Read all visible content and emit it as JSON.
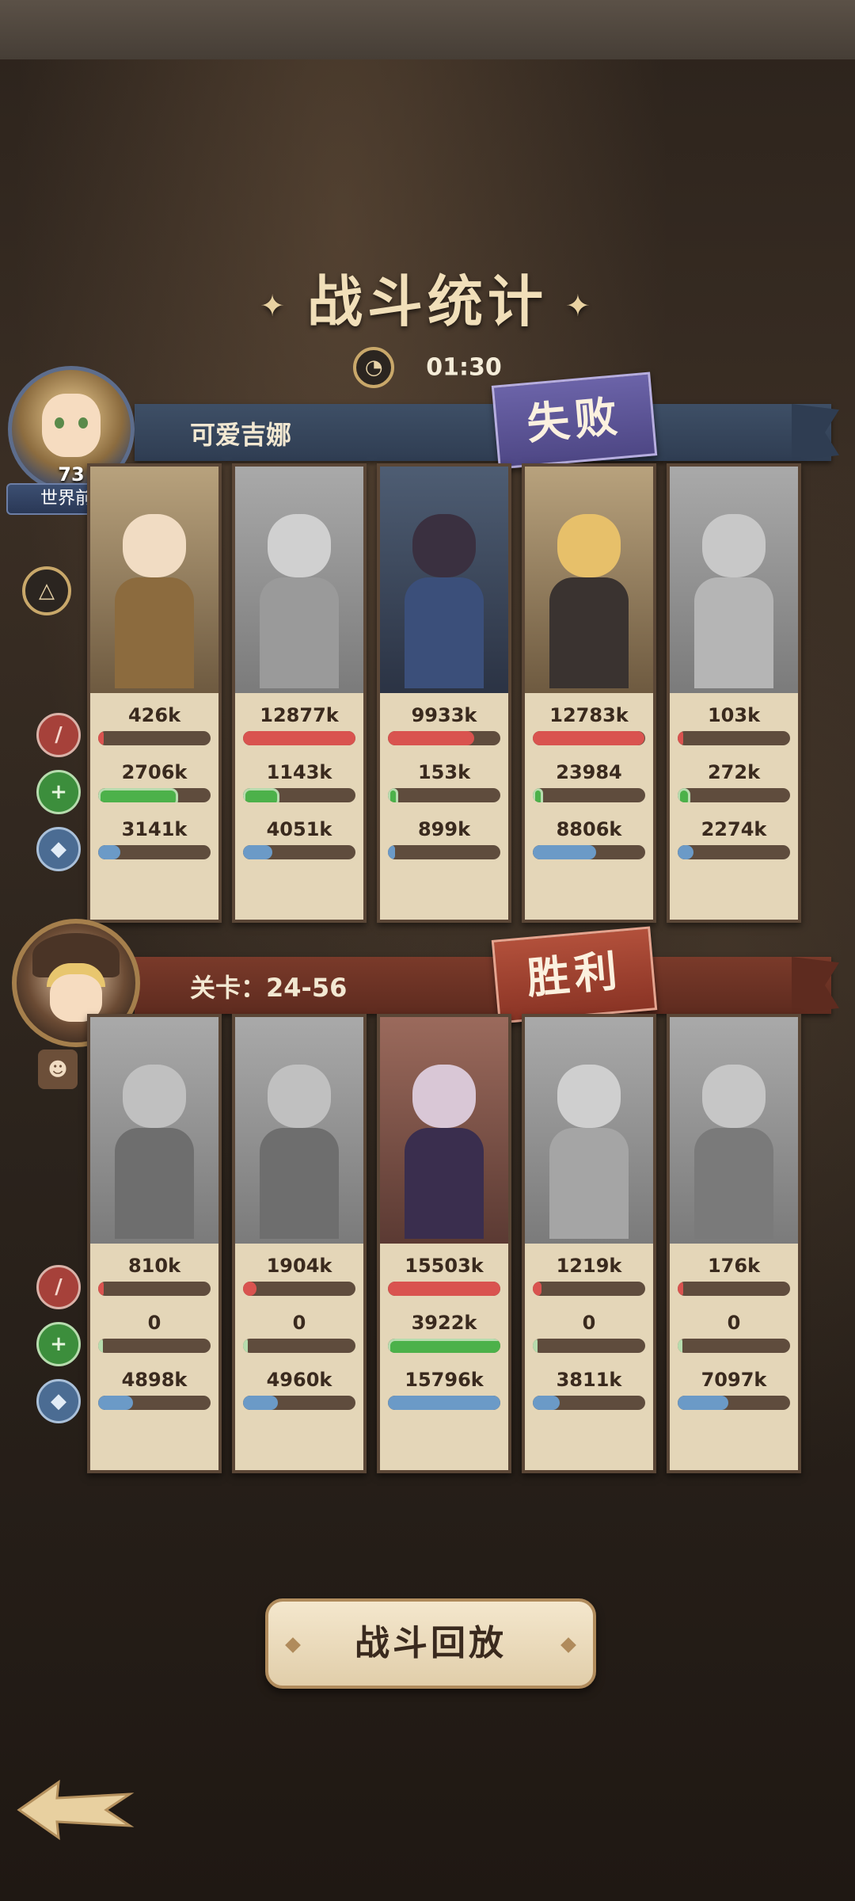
{
  "header": {
    "title": "战斗统计",
    "timer": "01:30"
  },
  "player": {
    "name": "可爱吉娜",
    "level": "73",
    "rank_label": "世界前计",
    "result": "失败"
  },
  "enemy": {
    "stage_label": "关卡：24-56",
    "result": "胜利"
  },
  "colors": {
    "damage": "#d9534f",
    "heal": "#4cb14a",
    "defense": "#6b9ac7",
    "lose_badge": "#5a539a",
    "win_badge": "#9e3f2f"
  },
  "top_cards": [
    {
      "damage": "426k",
      "heal": "2706k",
      "defense": "3141k",
      "damage_pct": 0.03,
      "heal_pct": 0.67,
      "defense_pct": 0.2
    },
    {
      "damage": "12877k",
      "heal": "1143k",
      "defense": "4051k",
      "damage_pct": 1.0,
      "heal_pct": 0.28,
      "defense_pct": 0.26
    },
    {
      "damage": "9933k",
      "heal": "153k",
      "defense": "899k",
      "damage_pct": 0.77,
      "heal_pct": 0.04,
      "defense_pct": 0.06
    },
    {
      "damage": "12783k",
      "heal": "23984",
      "defense": "8806k",
      "damage_pct": 0.99,
      "heal_pct": 0.01,
      "defense_pct": 0.56
    },
    {
      "damage": "103k",
      "heal": "272k",
      "defense": "2274k",
      "damage_pct": 0.01,
      "heal_pct": 0.07,
      "defense_pct": 0.14
    }
  ],
  "bottom_cards": [
    {
      "damage": "810k",
      "heal": "0",
      "defense": "4898k",
      "damage_pct": 0.05,
      "heal_pct": 0.0,
      "defense_pct": 0.31
    },
    {
      "damage": "1904k",
      "heal": "0",
      "defense": "4960k",
      "damage_pct": 0.12,
      "heal_pct": 0.0,
      "defense_pct": 0.31
    },
    {
      "damage": "15503k",
      "heal": "3922k",
      "defense": "15796k",
      "damage_pct": 1.0,
      "heal_pct": 1.0,
      "defense_pct": 1.0
    },
    {
      "damage": "1219k",
      "heal": "0",
      "defense": "3811k",
      "damage_pct": 0.08,
      "heal_pct": 0.0,
      "defense_pct": 0.24
    },
    {
      "damage": "176k",
      "heal": "0",
      "defense": "7097k",
      "damage_pct": 0.01,
      "heal_pct": 0.0,
      "defense_pct": 0.45
    }
  ],
  "footer": {
    "replay_label": "战斗回放"
  }
}
